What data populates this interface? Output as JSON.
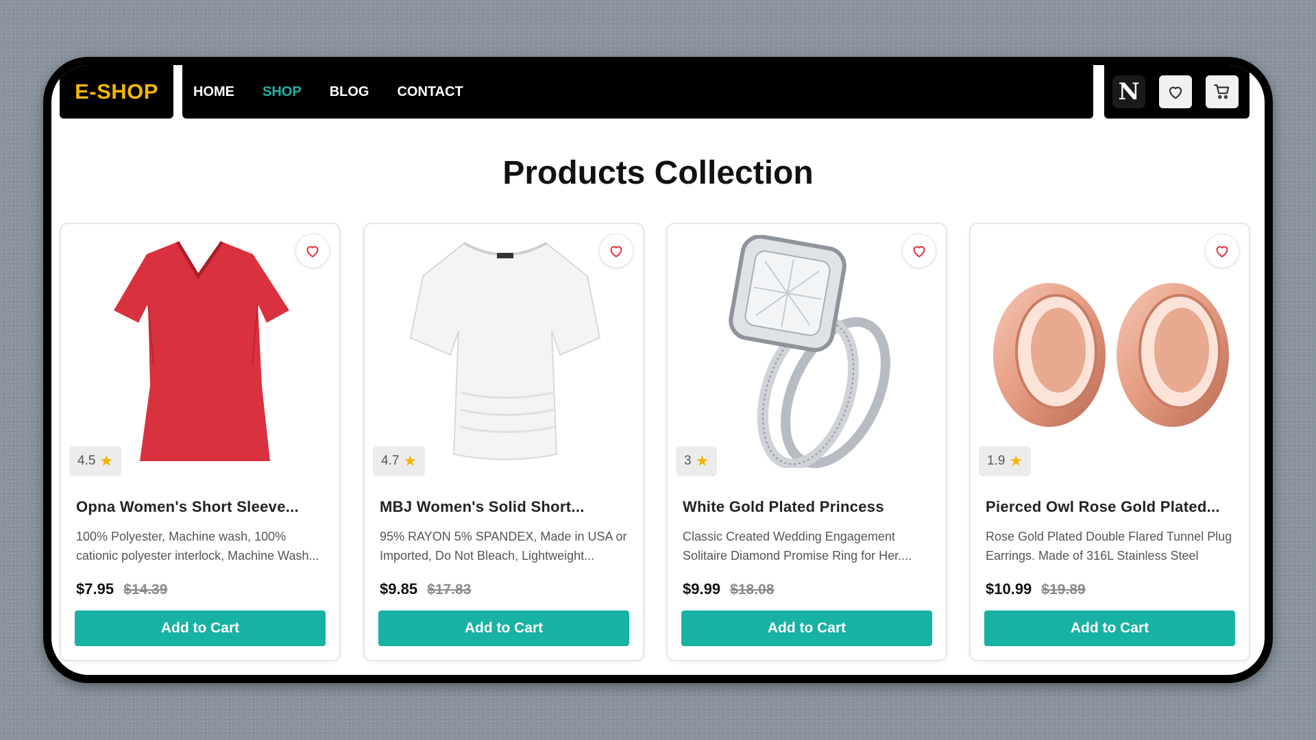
{
  "header": {
    "logo": "E-SHOP",
    "nav": [
      {
        "label": "HOME",
        "active": false
      },
      {
        "label": "SHOP",
        "active": true
      },
      {
        "label": "BLOG",
        "active": false
      },
      {
        "label": "CONTACT",
        "active": false
      }
    ],
    "profile_initial": "N",
    "icons": [
      "heart-icon",
      "cart-icon"
    ]
  },
  "page": {
    "title": "Products Collection"
  },
  "colors": {
    "accent": "#17b2a3",
    "logo": "#f5b800",
    "nav_active": "#20b2a6",
    "star": "#f4b400"
  },
  "products": [
    {
      "title": "Opna Women's Short Sleeve...",
      "description": "100% Polyester, Machine wash, 100% cationic polyester interlock, Machine Wash...",
      "rating": "4.5",
      "price": "$7.95",
      "old_price": "$14.39",
      "button": "Add to Cart",
      "image": "red-tshirt"
    },
    {
      "title": "MBJ Women's Solid Short...",
      "description": "95% RAYON 5% SPANDEX, Made in USA or Imported, Do Not Bleach, Lightweight...",
      "rating": "4.7",
      "price": "$9.85",
      "old_price": "$17.83",
      "button": "Add to Cart",
      "image": "white-top"
    },
    {
      "title": "White Gold Plated Princess",
      "description": "Classic Created Wedding Engagement Solitaire Diamond Promise Ring for Her....",
      "rating": "3",
      "price": "$9.99",
      "old_price": "$18.08",
      "button": "Add to Cart",
      "image": "diamond-ring"
    },
    {
      "title": "Pierced Owl Rose Gold Plated...",
      "description": "Rose Gold Plated Double Flared Tunnel Plug Earrings. Made of 316L Stainless Steel",
      "rating": "1.9",
      "price": "$10.99",
      "old_price": "$19.89",
      "button": "Add to Cart",
      "image": "rose-gold-plugs"
    }
  ]
}
